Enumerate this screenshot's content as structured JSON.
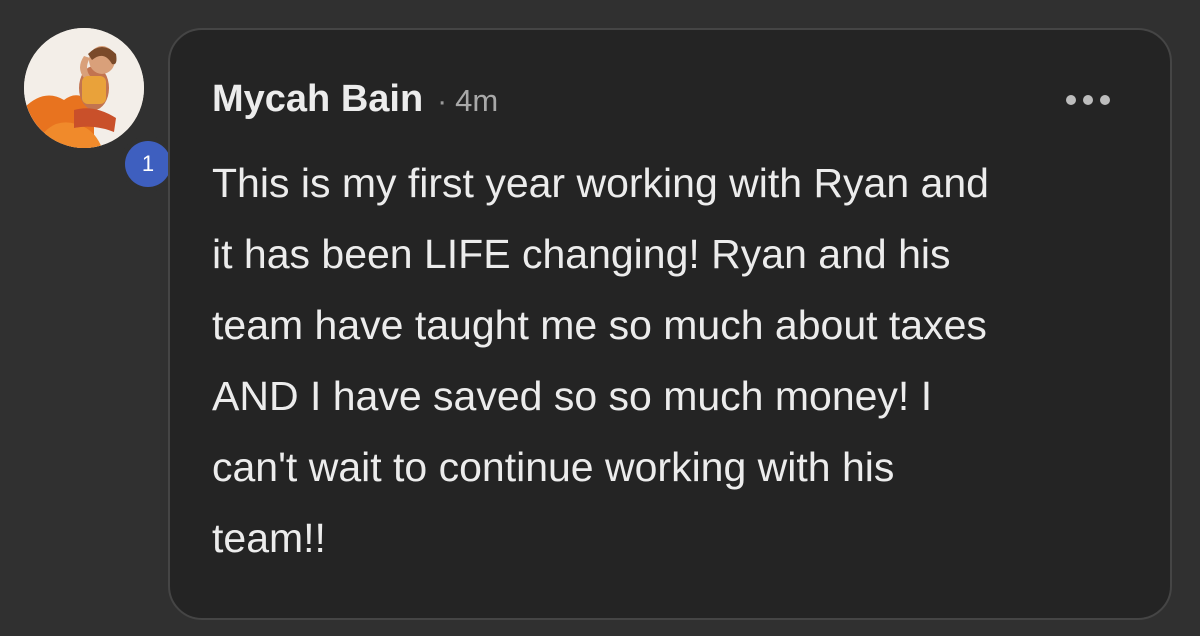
{
  "comment": {
    "avatar_badge": "1",
    "author": "Mycah Bain",
    "separator": "·",
    "time": "4m",
    "more_icon": "more-horizontal-icon",
    "lines": [
      "This is my first year working with Ryan and",
      "it has been LIFE changing! Ryan and his",
      "team have taught me so much about taxes",
      "AND I have saved so so much money! I",
      "can't wait to continue working with his",
      "team!!"
    ]
  },
  "colors": {
    "page_background": "#303030",
    "bubble_background": "#242424",
    "badge": "#3e5fbf",
    "text": "#ececec"
  }
}
